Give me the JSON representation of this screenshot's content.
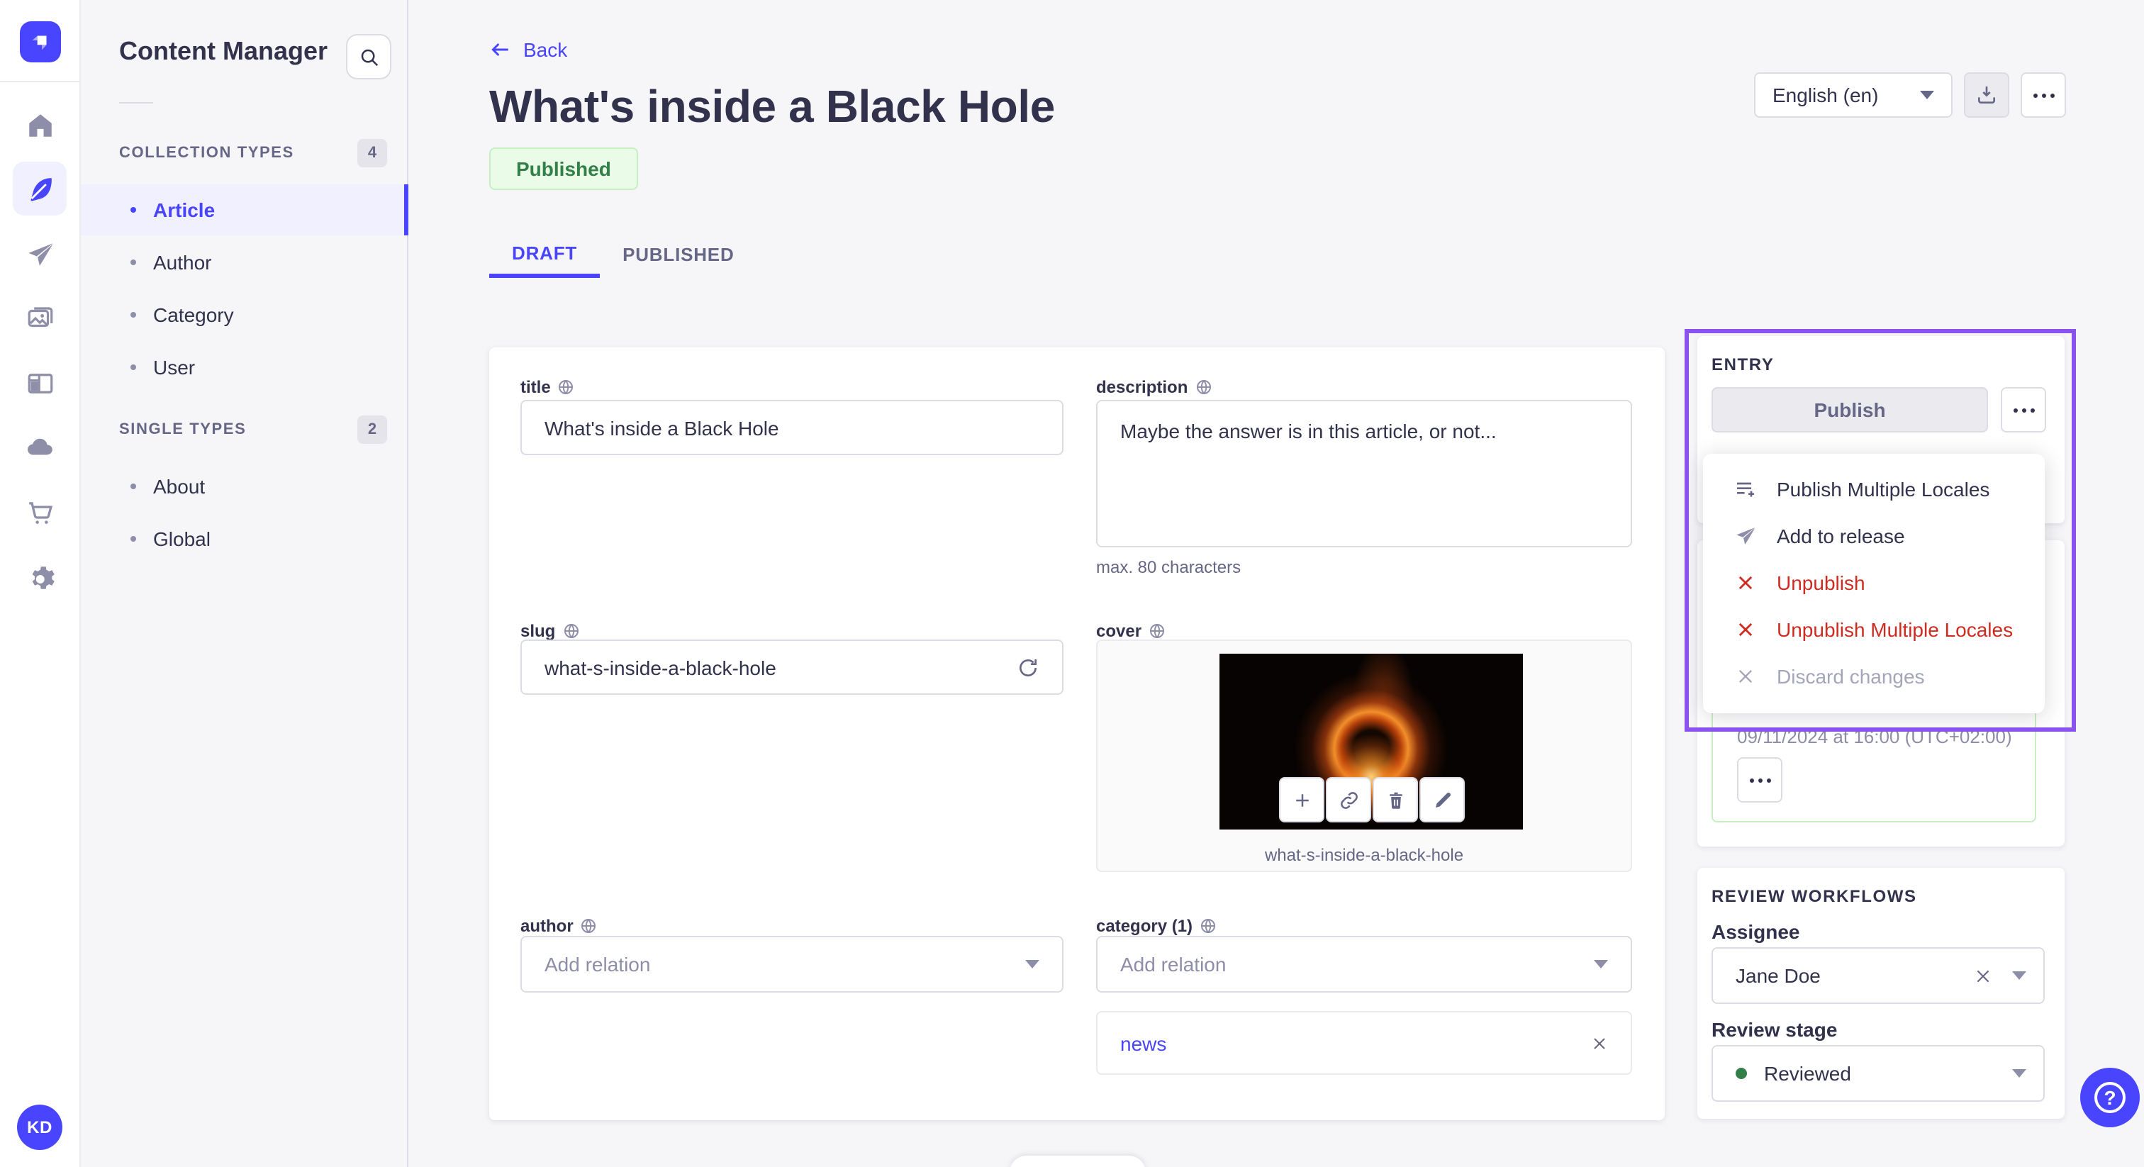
{
  "icon_rail": {
    "icons": [
      "strapi-logo",
      "home-icon",
      "content-manager-feather-icon",
      "releases-paper-plane-icon",
      "media-library-icon",
      "content-type-builder-icon",
      "cloud-icon",
      "marketplace-cart-icon",
      "settings-gear-icon"
    ],
    "avatar_initials": "KD"
  },
  "subnav": {
    "title": "Content Manager",
    "search_icon": "search-icon",
    "sections": [
      {
        "label": "COLLECTION TYPES",
        "count": "4",
        "items": [
          {
            "label": "Article"
          },
          {
            "label": "Author"
          },
          {
            "label": "Category"
          },
          {
            "label": "User"
          }
        ]
      },
      {
        "label": "SINGLE TYPES",
        "count": "2",
        "items": [
          {
            "label": "About"
          },
          {
            "label": "Global"
          }
        ]
      }
    ]
  },
  "header": {
    "back_label": "Back",
    "title": "What's inside a Black Hole",
    "status_badge": "Published",
    "locale_select": "English (en)",
    "tabs": [
      {
        "label": "DRAFT"
      },
      {
        "label": "PUBLISHED"
      }
    ]
  },
  "form": {
    "title": {
      "label": "title",
      "value": "What's inside a Black Hole"
    },
    "description": {
      "label": "description",
      "value": "Maybe the answer is in this article, or not...",
      "helper": "max. 80 characters"
    },
    "slug": {
      "label": "slug",
      "value": "what-s-inside-a-black-hole"
    },
    "cover": {
      "label": "cover",
      "caption": "what-s-inside-a-black-hole",
      "actions": [
        "plus-icon",
        "link-icon",
        "trash-icon",
        "pencil-icon"
      ]
    },
    "author": {
      "label": "author",
      "placeholder": "Add relation"
    },
    "category": {
      "label": "category (1)",
      "placeholder": "Add relation",
      "relation": "news"
    }
  },
  "entry_panel": {
    "title": "ENTRY",
    "publish_label": "Publish",
    "menu": [
      {
        "label": "Publish Multiple Locales",
        "icon": "list-plus-icon",
        "variant": "default"
      },
      {
        "label": "Add to release",
        "icon": "paper-plane-icon",
        "variant": "default"
      },
      {
        "label": "Unpublish",
        "icon": "cross-icon",
        "variant": "danger"
      },
      {
        "label": "Unpublish Multiple Locales",
        "icon": "cross-icon",
        "variant": "danger"
      },
      {
        "label": "Discard changes",
        "icon": "cross-icon",
        "variant": "disabled"
      }
    ],
    "scheduled_date": "09/11/2024 at 16:00 (UTC+02:00)"
  },
  "review_panel": {
    "title": "REVIEW WORKFLOWS",
    "assignee": {
      "label": "Assignee",
      "value": "Jane Doe"
    },
    "review_stage": {
      "label": "Review stage",
      "value": "Reviewed",
      "dot_color": "#328048"
    }
  },
  "colors": {
    "accent": "#4945ff",
    "highlight_purple": "#8a53f0",
    "danger": "#d02b20",
    "success_text": "#328048",
    "success_bg": "#eafbe7",
    "success_border": "#c6f0c2",
    "page_bg": "#f6f6f9"
  }
}
